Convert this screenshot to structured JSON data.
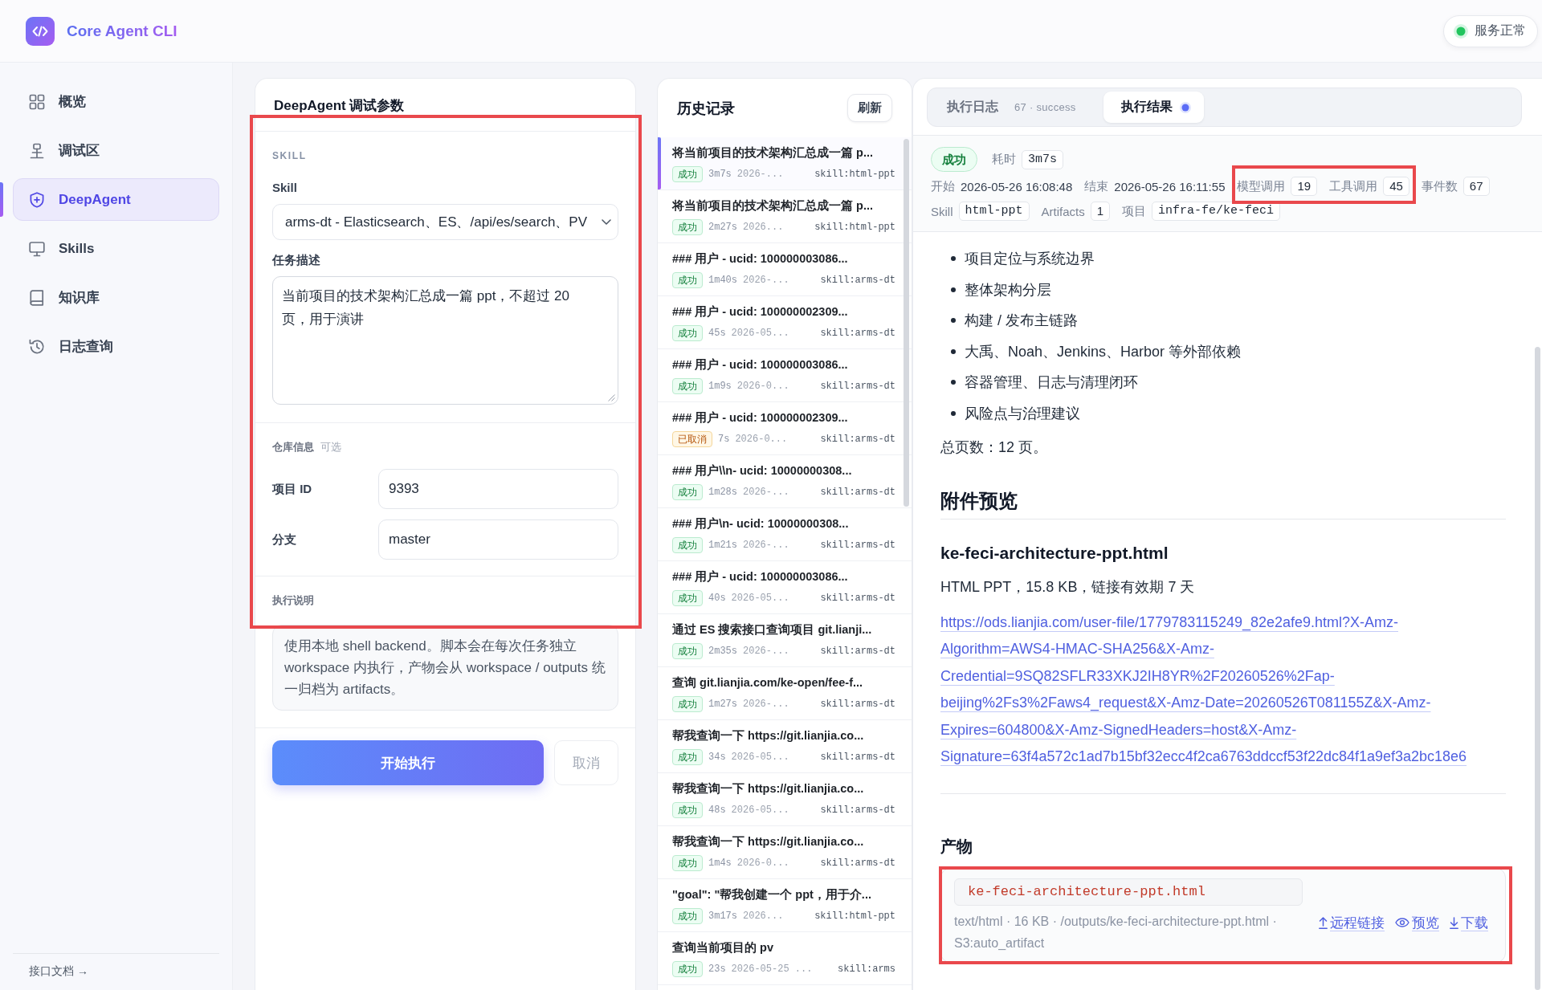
{
  "header": {
    "title": "Core Agent CLI",
    "service": {
      "label": "服务正常",
      "healthy": true
    }
  },
  "sidebar": {
    "items": [
      {
        "label": "概览",
        "selected": false
      },
      {
        "label": "调试区",
        "selected": false
      },
      {
        "label": "DeepAgent",
        "selected": true
      },
      {
        "label": "Skills",
        "selected": false
      },
      {
        "label": "知识库",
        "selected": false
      },
      {
        "label": "日志查询",
        "selected": false
      }
    ],
    "footer_link": "接口文档 →"
  },
  "params": {
    "title": "DeepAgent 调试参数",
    "highlighted": true,
    "skill_section": "SKILL",
    "skill_label": "Skill",
    "skill_value": "arms-dt - Elasticsearch、ES、/api/es/search、PV",
    "task_label": "任务描述",
    "task_value": "当前项目的技术架构汇总成一篇 ppt，不超过 20 页，用于演讲",
    "repo_section": "仓库信息",
    "repo_hint": "可选",
    "repo_fields": [
      {
        "label": "项目 ID",
        "value": "9393"
      },
      {
        "label": "分支",
        "value": "master"
      }
    ],
    "note_section": "执行说明",
    "note": "使用本地 shell backend。脚本会在每次任务独立 workspace 内执行，产物会从 workspace / outputs 统一归档为 artifacts。",
    "buttons": [
      {
        "label": "开始执行",
        "kind": "primary"
      },
      {
        "label": "取消",
        "kind": "secondary"
      }
    ]
  },
  "history": {
    "title": "历史记录",
    "refresh": "刷新",
    "items": [
      {
        "title": "将当前项目的技术架构汇总成一篇 p...",
        "status": "成功",
        "kind": "success",
        "duration": "3m7s",
        "date": "2026-...",
        "skill": "skill:html-ppt",
        "selected": true
      },
      {
        "title": "将当前项目的技术架构汇总成一篇 p...",
        "status": "成功",
        "kind": "success",
        "duration": "2m27s",
        "date": "2026...",
        "skill": "skill:html-ppt",
        "selected": false
      },
      {
        "title": "### 用户 - ucid: 100000003086...",
        "status": "成功",
        "kind": "success",
        "duration": "1m40s",
        "date": "2026-...",
        "skill": "skill:arms-dt",
        "selected": false
      },
      {
        "title": "### 用户 - ucid: 100000002309...",
        "status": "成功",
        "kind": "success",
        "duration": "45s",
        "date": "2026-05...",
        "skill": "skill:arms-dt",
        "selected": false
      },
      {
        "title": "### 用户 - ucid: 100000003086...",
        "status": "成功",
        "kind": "success",
        "duration": "1m9s",
        "date": "2026-0...",
        "skill": "skill:arms-dt",
        "selected": false
      },
      {
        "title": "### 用户 - ucid: 100000002309...",
        "status": "已取消",
        "kind": "cancelled",
        "duration": "7s",
        "date": "2026-0...",
        "skill": "skill:arms-dt",
        "selected": false
      },
      {
        "title": "### 用户\\\\n- ucid: 10000000308...",
        "status": "成功",
        "kind": "success",
        "duration": "1m28s",
        "date": "2026-...",
        "skill": "skill:arms-dt",
        "selected": false
      },
      {
        "title": "### 用户\\n- ucid: 10000000308...",
        "status": "成功",
        "kind": "success",
        "duration": "1m21s",
        "date": "2026-...",
        "skill": "skill:arms-dt",
        "selected": false
      },
      {
        "title": "### 用户 - ucid: 100000003086...",
        "status": "成功",
        "kind": "success",
        "duration": "40s",
        "date": "2026-05...",
        "skill": "skill:arms-dt",
        "selected": false
      },
      {
        "title": "通过 ES 搜索接口查询项目 git.lianji...",
        "status": "成功",
        "kind": "success",
        "duration": "2m35s",
        "date": "2026-...",
        "skill": "skill:arms-dt",
        "selected": false
      },
      {
        "title": "查询 git.lianjia.com/ke-open/fee-f...",
        "status": "成功",
        "kind": "success",
        "duration": "1m27s",
        "date": "2026-...",
        "skill": "skill:arms-dt",
        "selected": false
      },
      {
        "title": "帮我查询一下 https://git.lianjia.co...",
        "status": "成功",
        "kind": "success",
        "duration": "34s",
        "date": "2026-05...",
        "skill": "skill:arms-dt",
        "selected": false
      },
      {
        "title": "帮我查询一下 https://git.lianjia.co...",
        "status": "成功",
        "kind": "success",
        "duration": "48s",
        "date": "2026-05...",
        "skill": "skill:arms-dt",
        "selected": false
      },
      {
        "title": "帮我查询一下 https://git.lianjia.co...",
        "status": "成功",
        "kind": "success",
        "duration": "1m4s",
        "date": "2026-0...",
        "skill": "skill:arms-dt",
        "selected": false
      },
      {
        "title": "\"goal\": \"帮我创建一个 ppt，用于介...",
        "status": "成功",
        "kind": "success",
        "duration": "3m17s",
        "date": "2026...",
        "skill": "skill:html-ppt",
        "selected": false
      },
      {
        "title": "查询当前项目的 pv",
        "status": "成功",
        "kind": "success",
        "duration": "23s",
        "date": "2026-05-25 ...",
        "skill": "skill:arms",
        "selected": false
      }
    ]
  },
  "result": {
    "tabs": [
      {
        "label": "执行日志",
        "meta": "67 · success",
        "selected": false,
        "indicator": false
      },
      {
        "label": "执行结果",
        "selected": true,
        "indicator": true
      }
    ],
    "summary": {
      "status": {
        "label": "成功",
        "kind": "success"
      },
      "rows": [
        [
          {
            "label": "耗时",
            "value": "3m7s",
            "kind": "code",
            "highlighted": false
          }
        ],
        [
          {
            "label": "开始",
            "value": "2026-05-26 16:08:48",
            "kind": "text",
            "highlighted": false
          },
          {
            "label": "结束",
            "value": "2026-05-26 16:11:55",
            "kind": "text",
            "highlighted": false
          },
          {
            "label": "模型调用",
            "value": "19",
            "kind": "count",
            "highlighted": true
          },
          {
            "label": "工具调用",
            "value": "45",
            "kind": "count",
            "highlighted": true
          },
          {
            "label": "事件数",
            "value": "67",
            "kind": "count",
            "highlighted": false
          }
        ],
        [
          {
            "label": "Skill",
            "value": "html-ppt",
            "kind": "code",
            "highlighted": false
          },
          {
            "label": "Artifacts",
            "value": "1",
            "kind": "count",
            "highlighted": false
          },
          {
            "label": "项目",
            "value": "infra-fe/ke-feci",
            "kind": "code",
            "highlighted": false
          }
        ]
      ]
    },
    "document": {
      "bullets": [
        "项目定位与系统边界",
        "整体架构分层",
        "构建 / 发布主链路",
        "大禹、Noah、Jenkins、Harbor 等外部依赖",
        "容器管理、日志与清理闭环",
        "风险点与治理建议"
      ],
      "total_pages": "总页数：12 页。",
      "attachments_heading": "附件预览",
      "file_title": "ke-feci-architecture-ppt.html",
      "file_desc": "HTML PPT，15.8 KB，链接有效期 7 天",
      "file_link": "https://ods.lianjia.com/user-file/1779783115249_82e2afe9.html?X-Amz-Algorithm=AWS4-HMAC-SHA256&X-Amz-Credential=9SQ82SFLR33XKJ2IH8YR%2F20260526%2Fap-beijing%2Fs3%2Faws4_request&X-Amz-Date=20260526T081155Z&X-Amz-Expires=604800&X-Amz-SignedHeaders=host&X-Amz-Signature=63f4a572c1ad7b15bf32ecc4f2ca6763ddccf53f22dc84f1a9ef3a2bc18e6",
      "artifacts_heading": "产物",
      "artifact": {
        "name": "ke-feci-architecture-ppt.html",
        "meta": "text/html · 16 KB · /outputs/ke-feci-architecture-ppt.html · S3:auto_artifact",
        "actions": [
          "远程链接",
          "预览",
          "下载"
        ],
        "highlighted": true
      }
    }
  }
}
